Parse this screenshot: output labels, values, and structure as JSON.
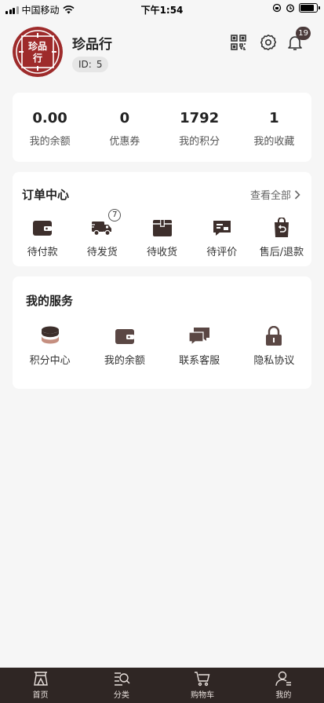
{
  "status_bar": {
    "carrier": "中国移动",
    "time": "下午1:54"
  },
  "profile": {
    "avatar_logo_text": "珍品行",
    "username": "珍品行",
    "id_label": "ID:",
    "id_value": "5",
    "notification_count": "19"
  },
  "stats": [
    {
      "value": "0.00",
      "label": "我的余额"
    },
    {
      "value": "0",
      "label": "优惠券"
    },
    {
      "value": "1792",
      "label": "我的积分"
    },
    {
      "value": "1",
      "label": "我的收藏"
    }
  ],
  "orders": {
    "title": "订单中心",
    "view_all": "查看全部",
    "items": [
      {
        "label": "待付款",
        "icon": "wallet-icon"
      },
      {
        "label": "待发货",
        "icon": "truck-icon",
        "badge": "7"
      },
      {
        "label": "待收货",
        "icon": "package-icon"
      },
      {
        "label": "待评价",
        "icon": "review-icon"
      },
      {
        "label": "售后/退款",
        "icon": "refund-bag-icon"
      }
    ]
  },
  "services": {
    "title": "我的服务",
    "items": [
      {
        "label": "积分中心",
        "icon": "coin-stack-icon"
      },
      {
        "label": "我的余额",
        "icon": "wallet-icon"
      },
      {
        "label": "联系客服",
        "icon": "chat-icon"
      },
      {
        "label": "隐私协议",
        "icon": "lock-icon"
      }
    ]
  },
  "tabbar": [
    {
      "label": "首页",
      "icon": "home-icon"
    },
    {
      "label": "分类",
      "icon": "category-search-icon"
    },
    {
      "label": "购物车",
      "icon": "cart-icon"
    },
    {
      "label": "我的",
      "icon": "user-icon"
    }
  ],
  "colors": {
    "brand_dark": "#3d2f2c",
    "logo_red": "#9e2b2b",
    "tabbar_bg": "#2f2624",
    "page_bg": "#f6f6f6"
  }
}
